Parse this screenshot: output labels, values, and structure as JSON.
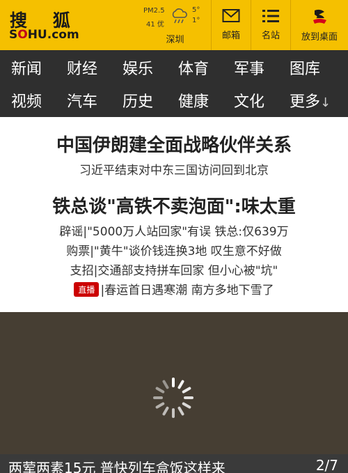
{
  "header": {
    "logo_cn": "搜 狐",
    "logo_en_prefix": "S",
    "logo_en_highlight": "O",
    "logo_en_suffix": "HU.com",
    "weather": {
      "pm_label": "PM2.5",
      "aqi": "41 优",
      "temp_high": "5°",
      "temp_low": "1°",
      "city": "深圳"
    },
    "mail_label": "邮箱",
    "sites_label": "名站",
    "desktop_label": "放到桌面"
  },
  "nav": {
    "row1": [
      "新闻",
      "财经",
      "娱乐",
      "体育",
      "军事",
      "图库"
    ],
    "row2": [
      "视频",
      "汽车",
      "历史",
      "健康",
      "文化",
      "更多"
    ]
  },
  "news": {
    "headline1": "中国伊朗建全面战略伙伴关系",
    "sub1": "习近平结束对中东三国访问回到北京",
    "headline2": "铁总谈\"高铁不卖泡面\":味太重",
    "sub2_1": "辟谣|\"5000万人站回家\"有误 铁总:仅639万",
    "sub2_2": "购票|\"黄牛\"谈价钱连换3地 叹生意不好做",
    "sub2_3": "支招|交通部支持拼车回家 但小心被\"坑\"",
    "live_badge": "直播",
    "sub2_4": "|春运首日遇寒潮 南方多地下雪了"
  },
  "media": {
    "caption": "两荤两素15元 普快列车盒饭这样来",
    "page": "2/7"
  },
  "colors": {
    "header_bg": "#f5c000",
    "nav_bg": "#2f2f2f",
    "media_bg": "#463e33",
    "badge_red": "#cc0000"
  }
}
